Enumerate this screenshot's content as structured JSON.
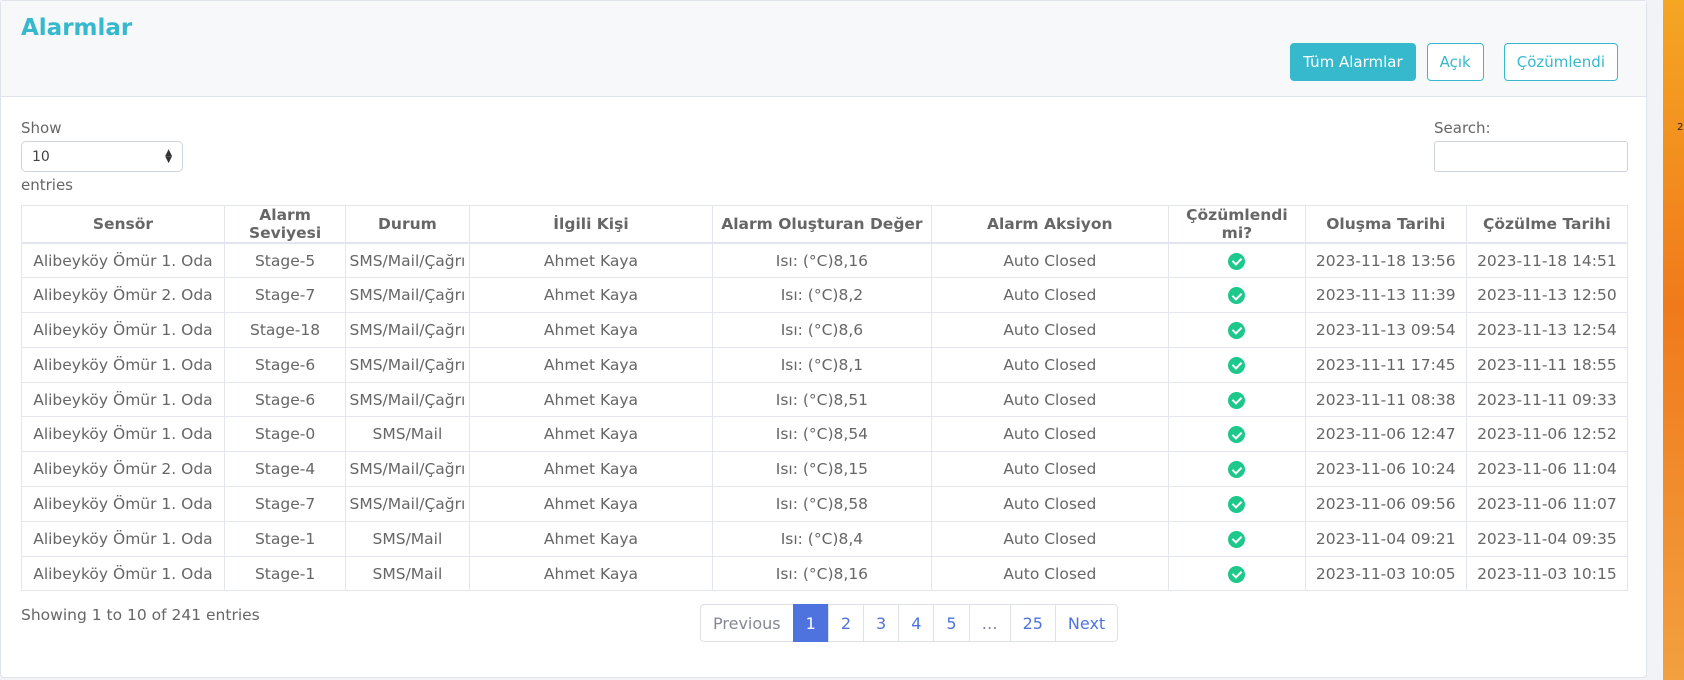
{
  "header": {
    "title": "Alarmlar"
  },
  "filters": [
    "Tüm Alarmlar",
    "Açık",
    "Çözümlendi"
  ],
  "length": {
    "label": "Show",
    "value": "10",
    "suffix": "entries"
  },
  "search": {
    "label": "Search:",
    "value": ""
  },
  "table": {
    "columns": [
      "Sensör",
      "Alarm Seviyesi",
      "Durum",
      "İlgili Kişi",
      "Alarm Oluşturan Değer",
      "Alarm Aksiyon",
      "Çözümlendi mi?",
      "Oluşma Tarihi",
      "Çözülme Tarihi"
    ],
    "rows": [
      [
        "Alibeyköy Ömür 1. Oda",
        "Stage-5",
        "SMS/Mail/Çağrı",
        "Ahmet Kaya",
        "Isı: (°C)8,16",
        "Auto Closed",
        "2023-11-18 13:56",
        "2023-11-18 14:51"
      ],
      [
        "Alibeyköy Ömür 2. Oda",
        "Stage-7",
        "SMS/Mail/Çağrı",
        "Ahmet Kaya",
        "Isı: (°C)8,2",
        "Auto Closed",
        "2023-11-13 11:39",
        "2023-11-13 12:50"
      ],
      [
        "Alibeyköy Ömür 1. Oda",
        "Stage-18",
        "SMS/Mail/Çağrı",
        "Ahmet Kaya",
        "Isı: (°C)8,6",
        "Auto Closed",
        "2023-11-13 09:54",
        "2023-11-13 12:54"
      ],
      [
        "Alibeyköy Ömür 1. Oda",
        "Stage-6",
        "SMS/Mail/Çağrı",
        "Ahmet Kaya",
        "Isı: (°C)8,1",
        "Auto Closed",
        "2023-11-11 17:45",
        "2023-11-11 18:55"
      ],
      [
        "Alibeyköy Ömür 1. Oda",
        "Stage-6",
        "SMS/Mail/Çağrı",
        "Ahmet Kaya",
        "Isı: (°C)8,51",
        "Auto Closed",
        "2023-11-11 08:38",
        "2023-11-11 09:33"
      ],
      [
        "Alibeyköy Ömür 1. Oda",
        "Stage-0",
        "SMS/Mail",
        "Ahmet Kaya",
        "Isı: (°C)8,54",
        "Auto Closed",
        "2023-11-06 12:47",
        "2023-11-06 12:52"
      ],
      [
        "Alibeyköy Ömür 2. Oda",
        "Stage-4",
        "SMS/Mail/Çağrı",
        "Ahmet Kaya",
        "Isı: (°C)8,15",
        "Auto Closed",
        "2023-11-06 10:24",
        "2023-11-06 11:04"
      ],
      [
        "Alibeyköy Ömür 1. Oda",
        "Stage-7",
        "SMS/Mail/Çağrı",
        "Ahmet Kaya",
        "Isı: (°C)8,58",
        "Auto Closed",
        "2023-11-06 09:56",
        "2023-11-06 11:07"
      ],
      [
        "Alibeyköy Ömür 1. Oda",
        "Stage-1",
        "SMS/Mail",
        "Ahmet Kaya",
        "Isı: (°C)8,4",
        "Auto Closed",
        "2023-11-04 09:21",
        "2023-11-04 09:35"
      ],
      [
        "Alibeyköy Ömür 1. Oda",
        "Stage-1",
        "SMS/Mail",
        "Ahmet Kaya",
        "Isı: (°C)8,16",
        "Auto Closed",
        "2023-11-03 10:05",
        "2023-11-03 10:15"
      ]
    ],
    "resolved_icon": "check-circle-icon",
    "resolved_color": "#1cc88a"
  },
  "footer": {
    "info": "Showing 1 to 10 of 241 entries",
    "pagination": [
      "Previous",
      "1",
      "2",
      "3",
      "4",
      "5",
      "…",
      "25",
      "Next"
    ],
    "active_page": "1"
  },
  "edge_text": "2",
  "colors": {
    "accent": "#36b9cc",
    "primary": "#4e73df",
    "success": "#1cc88a"
  }
}
